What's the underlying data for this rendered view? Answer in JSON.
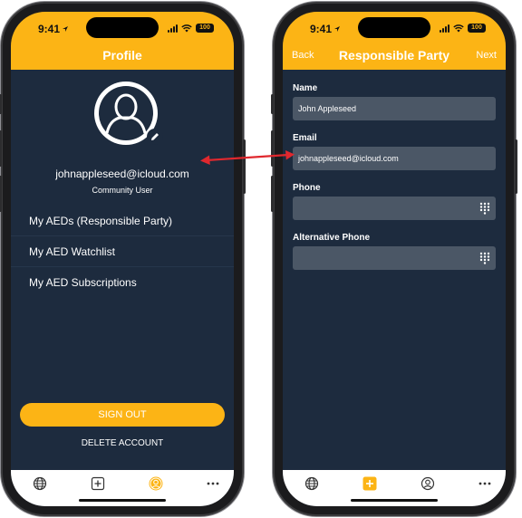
{
  "status": {
    "time": "9:41",
    "battery": "100"
  },
  "profile_screen": {
    "title": "Profile",
    "email": "johnappleseed@icloud.com",
    "role": "Community User",
    "menu": [
      {
        "label": "My AEDs (Responsible Party)"
      },
      {
        "label": "My AED Watchlist"
      },
      {
        "label": "My AED Subscriptions"
      }
    ],
    "sign_out": "SIGN OUT",
    "delete_account": "DELETE ACCOUNT",
    "tabs": [
      "globe-icon",
      "add-square-icon",
      "profile-icon",
      "more-icon"
    ],
    "active_tab": "profile-icon"
  },
  "responsible_screen": {
    "title": "Responsible Party",
    "back": "Back",
    "next": "Next",
    "fields": [
      {
        "label": "Name",
        "value": "John Appleseed"
      },
      {
        "label": "Email",
        "value": "johnappleseed@icloud.com"
      },
      {
        "label": "Phone",
        "value": ""
      },
      {
        "label": "Alternative Phone",
        "value": ""
      }
    ],
    "tabs": [
      "globe-icon",
      "add-square-icon",
      "profile-icon",
      "more-icon"
    ],
    "active_tab": "add-square-icon"
  },
  "colors": {
    "accent": "#fcb415",
    "background": "#1d2b3e",
    "field": "#4b5766",
    "arrow": "#e0282e"
  }
}
